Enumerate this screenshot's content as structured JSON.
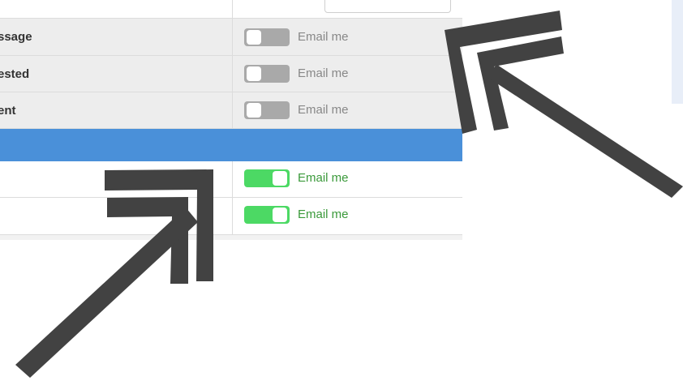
{
  "notifications": {
    "rows": [
      {
        "label": "ssage",
        "toggle_state": "off",
        "email_label": "Email me"
      },
      {
        "label": "ested",
        "toggle_state": "off",
        "email_label": "Email me"
      },
      {
        "label": "ent",
        "toggle_state": "off",
        "email_label": "Email me"
      },
      {
        "label": "",
        "toggle_state": "on",
        "email_label": "Email me"
      },
      {
        "label": "",
        "toggle_state": "on",
        "email_label": "Email me"
      }
    ]
  },
  "colors": {
    "section_header": "#4a90d9",
    "toggle_on": "#4cd964",
    "toggle_off": "#a9a9a9",
    "email_on_text": "#3b9a3b",
    "arrow": "#424242"
  },
  "annotations": {
    "arrows": [
      {
        "icon": "double-chevron-arrow-icon",
        "pointing": "up-left"
      },
      {
        "icon": "double-chevron-arrow-icon",
        "pointing": "up-right"
      }
    ]
  }
}
